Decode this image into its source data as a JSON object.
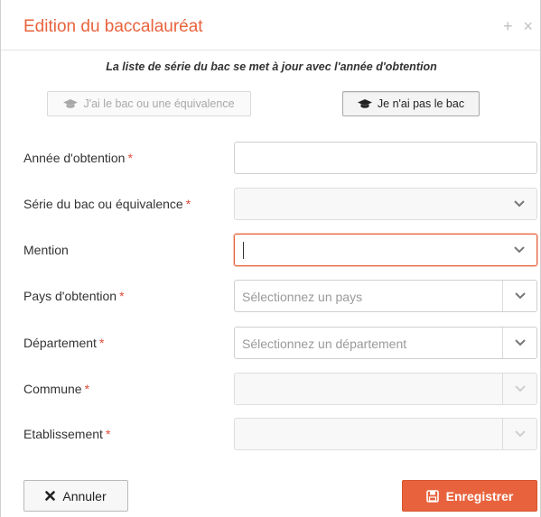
{
  "dialog": {
    "title": "Edition du baccalauréat",
    "icons": [
      "plus-icon",
      "close-icon"
    ],
    "notice": "La liste de série du bac se met à jour avec l'année d'obtention"
  },
  "choices": {
    "has_bac_label": "J'ai le bac ou une équivalence",
    "no_bac_label": "Je n'ai pas le bac",
    "selected": "no_bac"
  },
  "form": {
    "annee": {
      "label": "Année d'obtention",
      "required": "*",
      "value": ""
    },
    "serie": {
      "label": "Série du bac ou équivalence",
      "required": "*",
      "value": ""
    },
    "mention": {
      "label": "Mention",
      "value": ""
    },
    "pays": {
      "label": "Pays d'obtention",
      "required": "*",
      "placeholder": "Sélectionnez un pays"
    },
    "departement": {
      "label": "Département",
      "required": "*",
      "placeholder": "Sélectionnez un département"
    },
    "commune": {
      "label": "Commune",
      "required": "*",
      "value": ""
    },
    "etablissement": {
      "label": "Etablissement",
      "required": "*",
      "value": ""
    }
  },
  "footer": {
    "cancel_label": "Annuler",
    "save_label": "Enregistrer"
  },
  "colors": {
    "accent": "#e8633d",
    "required": "#e04b3a"
  }
}
